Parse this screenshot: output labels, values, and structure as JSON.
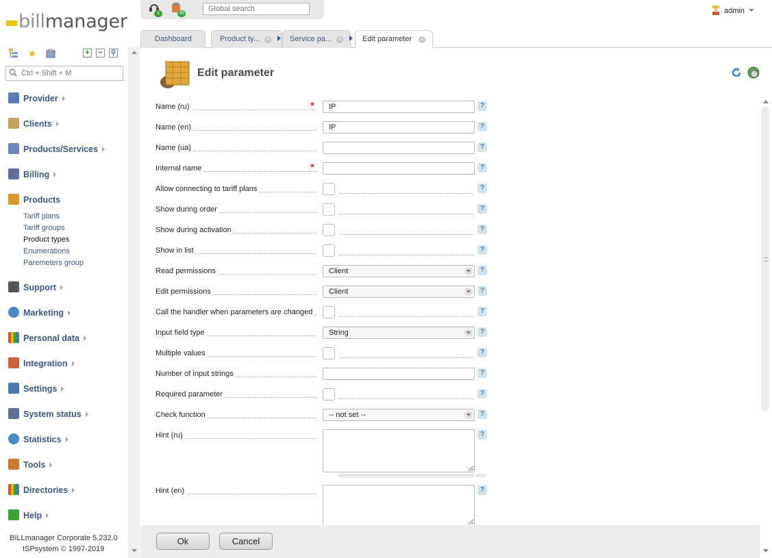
{
  "app": {
    "logo_prefix": "bill",
    "logo_suffix": "manager"
  },
  "sidebar": {
    "search_placeholder": "Ctrl + Shift + M",
    "menu": [
      {
        "label": "Provider",
        "icon": "provider-icon",
        "color": "#5a7cb5"
      },
      {
        "label": "Clients",
        "icon": "clients-icon",
        "color": "#c8a15c"
      },
      {
        "label": "Products/Services",
        "icon": "cart-icon",
        "color": "#6e86b8"
      },
      {
        "label": "Billing",
        "icon": "billing-icon",
        "color": "#5b6f9a"
      },
      {
        "label": "Products",
        "icon": "products-icon",
        "color": "#d99a2b"
      },
      {
        "label": "Support",
        "icon": "support-icon",
        "color": "#555555"
      },
      {
        "label": "Marketing",
        "icon": "marketing-icon",
        "color": "#4a87c6"
      },
      {
        "label": "Personal data",
        "icon": "personal-data-icon",
        "color": "#c85a2b"
      },
      {
        "label": "Integration",
        "icon": "integration-icon",
        "color": "#d0603a"
      },
      {
        "label": "Settings",
        "icon": "settings-icon",
        "color": "#4a78b0"
      },
      {
        "label": "System status",
        "icon": "system-status-icon",
        "color": "#5b6f9a"
      },
      {
        "label": "Statistics",
        "icon": "statistics-icon",
        "color": "#4a87c6"
      },
      {
        "label": "Tools",
        "icon": "tools-icon",
        "color": "#c87b2b"
      },
      {
        "label": "Directories",
        "icon": "directories-icon",
        "color": "#c85a2b"
      },
      {
        "label": "Help",
        "icon": "help-icon",
        "color": "#3aa336"
      }
    ],
    "submenu": [
      "Tariff plans",
      "Tariff groups",
      "Product types",
      "Enumerations",
      "Paremeters group"
    ],
    "footer": {
      "version": "BILLmanager Corporate 5.232.0",
      "copyright": "ISPsystem © 1997-2019"
    }
  },
  "topbar": {
    "search_placeholder": "Global search",
    "notifications": [
      {
        "icon": "headset-icon",
        "count": "1"
      },
      {
        "icon": "tasks-icon",
        "count": "35"
      }
    ],
    "user": "admin"
  },
  "tabs": [
    {
      "label": "Dashboard"
    },
    {
      "label": "Product ty..."
    },
    {
      "label": "Service pa..."
    },
    {
      "label": "Edit parameter"
    }
  ],
  "page": {
    "title": "Edit parameter"
  },
  "form": {
    "name_ru": {
      "label": "Name (ru)",
      "value": "IP"
    },
    "name_en": {
      "label": "Name (en)",
      "value": "IP"
    },
    "name_ua": {
      "label": "Name (ua)",
      "value": ""
    },
    "internal_name": {
      "label": "Internal name",
      "value": ""
    },
    "allow_tariff": {
      "label": "Allow connecting to tariff plans"
    },
    "show_order": {
      "label": "Show during order"
    },
    "show_activation": {
      "label": "Show during activation"
    },
    "show_list": {
      "label": "Show in list"
    },
    "read_perm": {
      "label": "Read permissions",
      "value": "Client"
    },
    "edit_perm": {
      "label": "Edit permissions",
      "value": "Client"
    },
    "call_handler": {
      "label": "Call the handler when parameters are changed"
    },
    "input_type": {
      "label": "Input field type",
      "value": "String"
    },
    "multiple": {
      "label": "Multiple values"
    },
    "num_strings": {
      "label": "Number of input strings",
      "value": ""
    },
    "required": {
      "label": "Required parameter"
    },
    "check_func": {
      "label": "Check function",
      "value": "-- not set --"
    },
    "hint_ru": {
      "label": "Hint (ru)"
    },
    "hint_en": {
      "label": "Hint (en)"
    }
  },
  "buttons": {
    "ok": "Ok",
    "cancel": "Cancel"
  }
}
